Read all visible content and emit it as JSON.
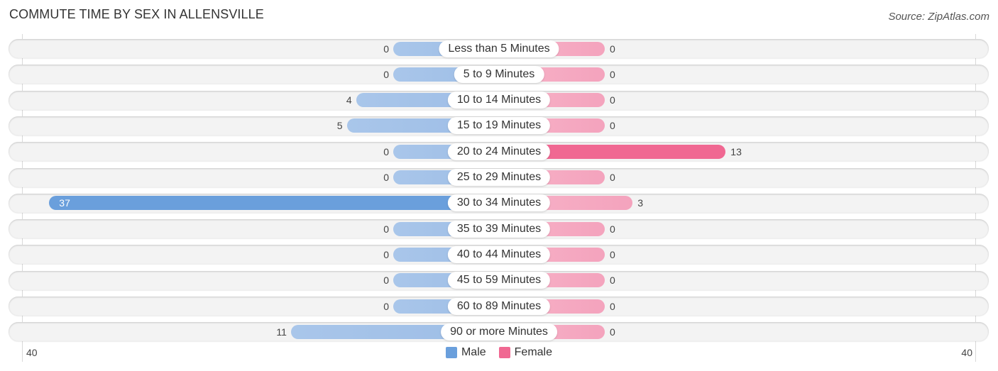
{
  "chart_data": {
    "type": "bar",
    "orientation": "horizontal-diverging",
    "title": "COMMUTE TIME BY SEX IN ALLENSVILLE",
    "source": "Source: ZipAtlas.com",
    "categories": [
      "Less than 5 Minutes",
      "5 to 9 Minutes",
      "10 to 14 Minutes",
      "15 to 19 Minutes",
      "20 to 24 Minutes",
      "25 to 29 Minutes",
      "30 to 34 Minutes",
      "35 to 39 Minutes",
      "40 to 44 Minutes",
      "45 to 59 Minutes",
      "60 to 89 Minutes",
      "90 or more Minutes"
    ],
    "series": [
      {
        "name": "Male",
        "color": "#6a9fdc",
        "values": [
          0,
          0,
          4,
          5,
          0,
          0,
          37,
          0,
          0,
          0,
          0,
          11
        ]
      },
      {
        "name": "Female",
        "color": "#f06892",
        "values": [
          0,
          0,
          0,
          0,
          13,
          0,
          3,
          0,
          0,
          0,
          0,
          0
        ]
      }
    ],
    "axis": {
      "left_label": "40",
      "right_label": "40",
      "max": 40
    },
    "legend": {
      "position": "bottom-center",
      "entries": [
        "Male",
        "Female"
      ]
    },
    "grid": false
  }
}
